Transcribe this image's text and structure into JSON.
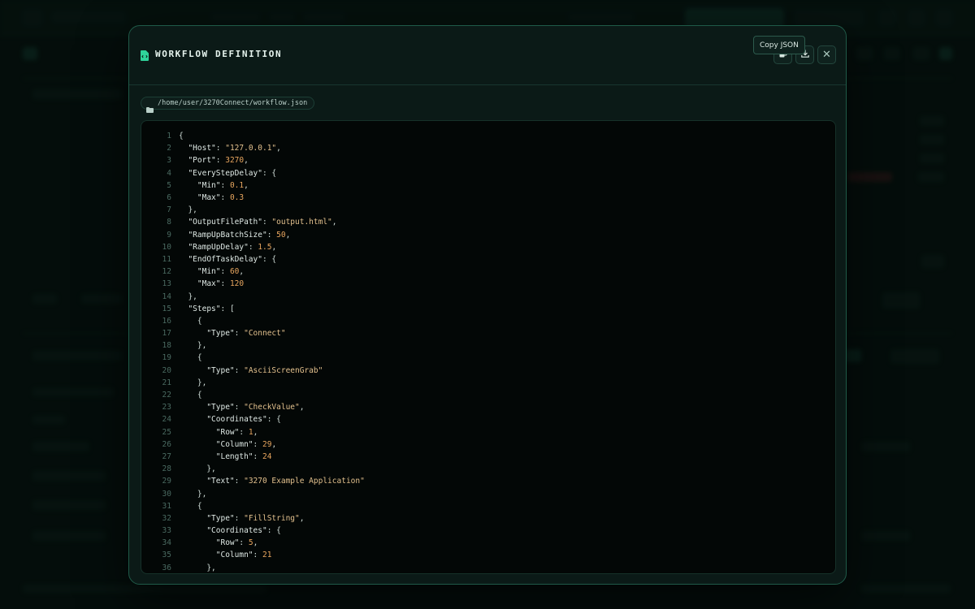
{
  "modal": {
    "title": "WORKFLOW DEFINITION",
    "tooltip": "Copy JSON",
    "file_path": "/home/user/3270Connect/workflow.json",
    "icons": {
      "title": "file-code-icon",
      "path": "folder-icon",
      "copy": "copy-icon",
      "download": "download-icon",
      "close": "close-icon"
    },
    "close_glyph": "✕"
  },
  "colors": {
    "accent": "#2fd39a",
    "border": "#1f5a48",
    "string": "#e2c08d",
    "number": "#e8a65f"
  },
  "code_lines": [
    [
      [
        "p",
        "{"
      ]
    ],
    [
      [
        "i",
        "  "
      ],
      [
        "k",
        "\"Host\""
      ],
      [
        "p",
        ": "
      ],
      [
        "s",
        "\"127.0.0.1\""
      ],
      [
        "p",
        ","
      ]
    ],
    [
      [
        "i",
        "  "
      ],
      [
        "k",
        "\"Port\""
      ],
      [
        "p",
        ": "
      ],
      [
        "n",
        "3270"
      ],
      [
        "p",
        ","
      ]
    ],
    [
      [
        "i",
        "  "
      ],
      [
        "k",
        "\"EveryStepDelay\""
      ],
      [
        "p",
        ": {"
      ]
    ],
    [
      [
        "i",
        "    "
      ],
      [
        "k",
        "\"Min\""
      ],
      [
        "p",
        ": "
      ],
      [
        "n",
        "0.1"
      ],
      [
        "p",
        ","
      ]
    ],
    [
      [
        "i",
        "    "
      ],
      [
        "k",
        "\"Max\""
      ],
      [
        "p",
        ": "
      ],
      [
        "n",
        "0.3"
      ]
    ],
    [
      [
        "i",
        "  "
      ],
      [
        "p",
        "},"
      ]
    ],
    [
      [
        "i",
        "  "
      ],
      [
        "k",
        "\"OutputFilePath\""
      ],
      [
        "p",
        ": "
      ],
      [
        "s",
        "\"output.html\""
      ],
      [
        "p",
        ","
      ]
    ],
    [
      [
        "i",
        "  "
      ],
      [
        "k",
        "\"RampUpBatchSize\""
      ],
      [
        "p",
        ": "
      ],
      [
        "n",
        "50"
      ],
      [
        "p",
        ","
      ]
    ],
    [
      [
        "i",
        "  "
      ],
      [
        "k",
        "\"RampUpDelay\""
      ],
      [
        "p",
        ": "
      ],
      [
        "n",
        "1.5"
      ],
      [
        "p",
        ","
      ]
    ],
    [
      [
        "i",
        "  "
      ],
      [
        "k",
        "\"EndOfTaskDelay\""
      ],
      [
        "p",
        ": {"
      ]
    ],
    [
      [
        "i",
        "    "
      ],
      [
        "k",
        "\"Min\""
      ],
      [
        "p",
        ": "
      ],
      [
        "n",
        "60"
      ],
      [
        "p",
        ","
      ]
    ],
    [
      [
        "i",
        "    "
      ],
      [
        "k",
        "\"Max\""
      ],
      [
        "p",
        ": "
      ],
      [
        "n",
        "120"
      ]
    ],
    [
      [
        "i",
        "  "
      ],
      [
        "p",
        "},"
      ]
    ],
    [
      [
        "i",
        "  "
      ],
      [
        "k",
        "\"Steps\""
      ],
      [
        "p",
        ": ["
      ]
    ],
    [
      [
        "i",
        "    "
      ],
      [
        "p",
        "{"
      ]
    ],
    [
      [
        "i",
        "      "
      ],
      [
        "k",
        "\"Type\""
      ],
      [
        "p",
        ": "
      ],
      [
        "s",
        "\"Connect\""
      ]
    ],
    [
      [
        "i",
        "    "
      ],
      [
        "p",
        "},"
      ]
    ],
    [
      [
        "i",
        "    "
      ],
      [
        "p",
        "{"
      ]
    ],
    [
      [
        "i",
        "      "
      ],
      [
        "k",
        "\"Type\""
      ],
      [
        "p",
        ": "
      ],
      [
        "s",
        "\"AsciiScreenGrab\""
      ]
    ],
    [
      [
        "i",
        "    "
      ],
      [
        "p",
        "},"
      ]
    ],
    [
      [
        "i",
        "    "
      ],
      [
        "p",
        "{"
      ]
    ],
    [
      [
        "i",
        "      "
      ],
      [
        "k",
        "\"Type\""
      ],
      [
        "p",
        ": "
      ],
      [
        "s",
        "\"CheckValue\""
      ],
      [
        "p",
        ","
      ]
    ],
    [
      [
        "i",
        "      "
      ],
      [
        "k",
        "\"Coordinates\""
      ],
      [
        "p",
        ": {"
      ]
    ],
    [
      [
        "i",
        "        "
      ],
      [
        "k",
        "\"Row\""
      ],
      [
        "p",
        ": "
      ],
      [
        "n",
        "1"
      ],
      [
        "p",
        ","
      ]
    ],
    [
      [
        "i",
        "        "
      ],
      [
        "k",
        "\"Column\""
      ],
      [
        "p",
        ": "
      ],
      [
        "n",
        "29"
      ],
      [
        "p",
        ","
      ]
    ],
    [
      [
        "i",
        "        "
      ],
      [
        "k",
        "\"Length\""
      ],
      [
        "p",
        ": "
      ],
      [
        "n",
        "24"
      ]
    ],
    [
      [
        "i",
        "      "
      ],
      [
        "p",
        "},"
      ]
    ],
    [
      [
        "i",
        "      "
      ],
      [
        "k",
        "\"Text\""
      ],
      [
        "p",
        ": "
      ],
      [
        "s",
        "\"3270 Example Application\""
      ]
    ],
    [
      [
        "i",
        "    "
      ],
      [
        "p",
        "},"
      ]
    ],
    [
      [
        "i",
        "    "
      ],
      [
        "p",
        "{"
      ]
    ],
    [
      [
        "i",
        "      "
      ],
      [
        "k",
        "\"Type\""
      ],
      [
        "p",
        ": "
      ],
      [
        "s",
        "\"FillString\""
      ],
      [
        "p",
        ","
      ]
    ],
    [
      [
        "i",
        "      "
      ],
      [
        "k",
        "\"Coordinates\""
      ],
      [
        "p",
        ": {"
      ]
    ],
    [
      [
        "i",
        "        "
      ],
      [
        "k",
        "\"Row\""
      ],
      [
        "p",
        ": "
      ],
      [
        "n",
        "5"
      ],
      [
        "p",
        ","
      ]
    ],
    [
      [
        "i",
        "        "
      ],
      [
        "k",
        "\"Column\""
      ],
      [
        "p",
        ": "
      ],
      [
        "n",
        "21"
      ]
    ],
    [
      [
        "i",
        "      "
      ],
      [
        "p",
        "},"
      ]
    ]
  ]
}
